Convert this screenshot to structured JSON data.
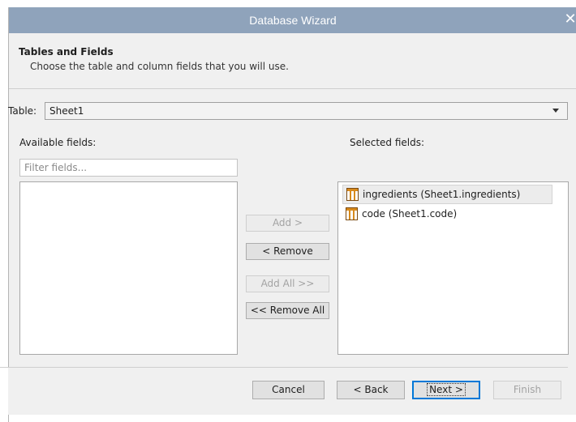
{
  "window": {
    "title": "Database Wizard",
    "close_glyph": "✕",
    "close_icon": "close-icon"
  },
  "header": {
    "title": "Tables and Fields",
    "subtitle": "Choose the table and column fields that you will use."
  },
  "table": {
    "label": "Table:",
    "selected": "Sheet1"
  },
  "available": {
    "label": "Available fields:",
    "filter_placeholder": "Filter fields...",
    "filter_value": "",
    "items": []
  },
  "selected": {
    "label": "Selected fields:",
    "items": [
      {
        "label": "ingredients (Sheet1.ingredients)",
        "icon": "table-column-icon"
      },
      {
        "label": "code (Sheet1.code)",
        "icon": "table-column-icon"
      }
    ]
  },
  "actions": {
    "add": "Add >",
    "remove": "< Remove",
    "add_all": "Add All >>",
    "remove_all": "<< Remove All"
  },
  "footer": {
    "cancel": "Cancel",
    "back": "< Back",
    "next": "Next >",
    "finish": "Finish"
  },
  "colors": {
    "titlebar": "#8fa3bb",
    "column_icon": "#d88a1c",
    "focus": "#0078d7"
  }
}
